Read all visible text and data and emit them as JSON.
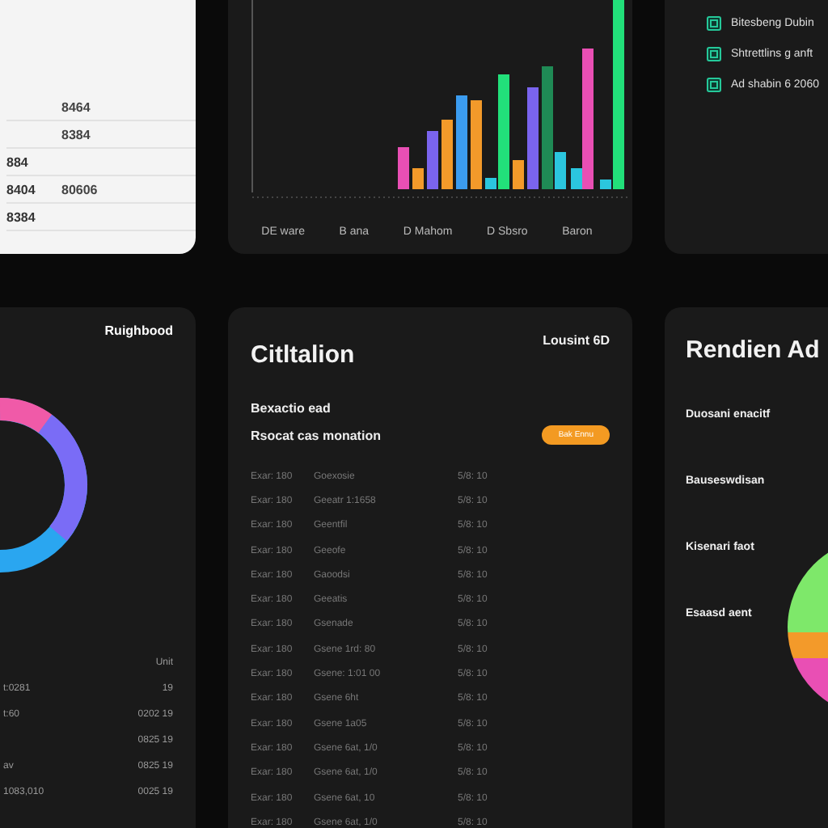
{
  "summary_card": {
    "rows": [
      {
        "label": "",
        "value": "8464"
      },
      {
        "label": "",
        "value": "8384"
      },
      {
        "label": "884",
        "value": ""
      },
      {
        "label": "8404",
        "value": "80606"
      },
      {
        "label": "8384",
        "value": ""
      }
    ]
  },
  "bar_card": {
    "x_labels": [
      "DE ware",
      "B ana",
      "D Mahom",
      "D Sbsro",
      "Baron"
    ]
  },
  "list_card": {
    "items": [
      {
        "label": "Bitesbeng Dubin"
      },
      {
        "label": "Shtrettlins g anft"
      },
      {
        "label": "Ad shabin 6 2060"
      }
    ]
  },
  "donut_card": {
    "title": "Ruighbood",
    "header": "Unit",
    "rows": [
      {
        "label": "t:0281",
        "value": "19"
      },
      {
        "label": "t:60",
        "value": "0202 19"
      },
      {
        "label": "",
        "value": "0825 19"
      },
      {
        "label": "av",
        "value": "0825 19"
      },
      {
        "label": "1083,010",
        "value": "0025 19"
      }
    ]
  },
  "citation_card": {
    "title": "Citltalion",
    "corner": "Lousint 6D",
    "subtitle": "Bexactio ead",
    "section": "Rsocat cas monation",
    "button": "Bak Ennu",
    "rows": [
      [
        "Exar: 180",
        "Goexosie",
        "5/8: 10"
      ],
      [
        "Exar: 180",
        "Geeatr 1:1658",
        "5/8: 10"
      ],
      [
        "Exar: 180",
        "Geentfil",
        "5/8: 10"
      ],
      [
        "Exar: 180",
        "Geeofe",
        "5/8: 10"
      ],
      [
        "Exar: 180",
        "Gaoodsi",
        "5/8: 10"
      ],
      [
        "Exar: 180",
        "Geeatis",
        "5/8: 10"
      ],
      [
        "Exar: 180",
        "Gsenade",
        "5/8: 10"
      ],
      [
        "Exar: 180",
        "Gsene 1rd: 80",
        "5/8: 10"
      ],
      [
        "Exar: 180",
        "Gsene: 1:01 00",
        "5/8: 10"
      ],
      [
        "Exar: 180",
        "Gsene 6ht",
        "5/8: 10"
      ],
      [
        "Exar: 180",
        "Gsene 1a05",
        "5/8: 10"
      ],
      [
        "Exar: 180",
        "Gsene 6at, 1/0",
        "5/8: 10"
      ],
      [
        "Exar: 180",
        "Gsene 6at, 1/0",
        "5/8: 10"
      ],
      [
        "Exar: 180",
        "Gsene 6at, 10",
        "5/8: 10"
      ],
      [
        "Exar: 180",
        "Gsene 6at, 1/0",
        "5/8: 10"
      ]
    ]
  },
  "pie_card": {
    "title": "Rendien Ad",
    "labels": [
      "Duosani enacitf",
      "Bauseswdisan",
      "Kisenari faot",
      "Esaasd aent"
    ]
  }
}
